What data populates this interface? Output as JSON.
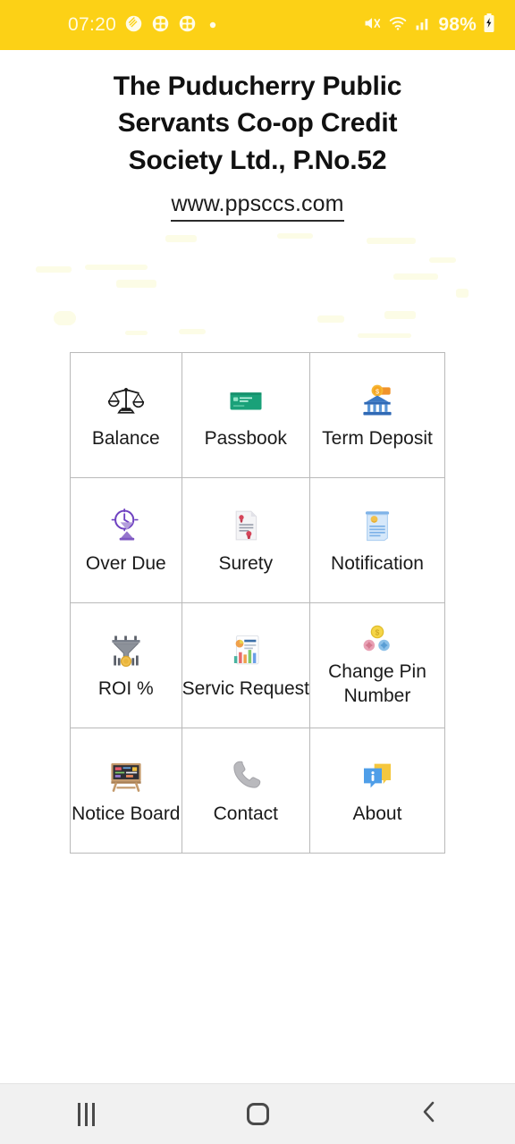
{
  "status_bar": {
    "time": "07:20",
    "left_icons": [
      "leaf-shield-icon",
      "app-grid-icon-1",
      "app-grid-icon-2",
      "dot-indicator-icon"
    ],
    "right_icons": [
      "mute-icon",
      "wifi-icon",
      "signal-bars-icon"
    ],
    "battery_percent": "98%",
    "battery_icon": "charging-battery-icon",
    "background_color": "#FCD116"
  },
  "header": {
    "title": "The Puducherry Public Servants Co-op Credit Society Ltd., P.No.52",
    "website": "www.ppsccs.com"
  },
  "menu": {
    "items": [
      {
        "label": "Balance",
        "icon": "balance-scale-icon"
      },
      {
        "label": "Passbook",
        "icon": "passbook-card-icon"
      },
      {
        "label": "Term Deposit",
        "icon": "bank-money-icon"
      },
      {
        "label": "Over Due",
        "icon": "clock-hourglass-icon"
      },
      {
        "label": "Surety",
        "icon": "document-seal-icon"
      },
      {
        "label": "Notification",
        "icon": "scroll-notice-icon"
      },
      {
        "label": "ROI %",
        "icon": "funnel-medal-icon"
      },
      {
        "label": "Servic Request",
        "icon": "report-chart-icon"
      },
      {
        "label": "Change Pin Number",
        "icon": "coin-flowers-icon"
      },
      {
        "label": "Notice Board",
        "icon": "blackboard-icon"
      },
      {
        "label": "Contact",
        "icon": "phone-icon"
      },
      {
        "label": "About",
        "icon": "info-bubble-icon"
      }
    ]
  },
  "nav_bar": {
    "recents_label": "recents-button",
    "home_label": "home-button",
    "back_label": "back-button"
  },
  "colors": {
    "status_bar": "#FCD116",
    "grid_border": "#b9b9b9",
    "text": "#1a1a1a",
    "nav_bar": "#f1f1f1"
  }
}
